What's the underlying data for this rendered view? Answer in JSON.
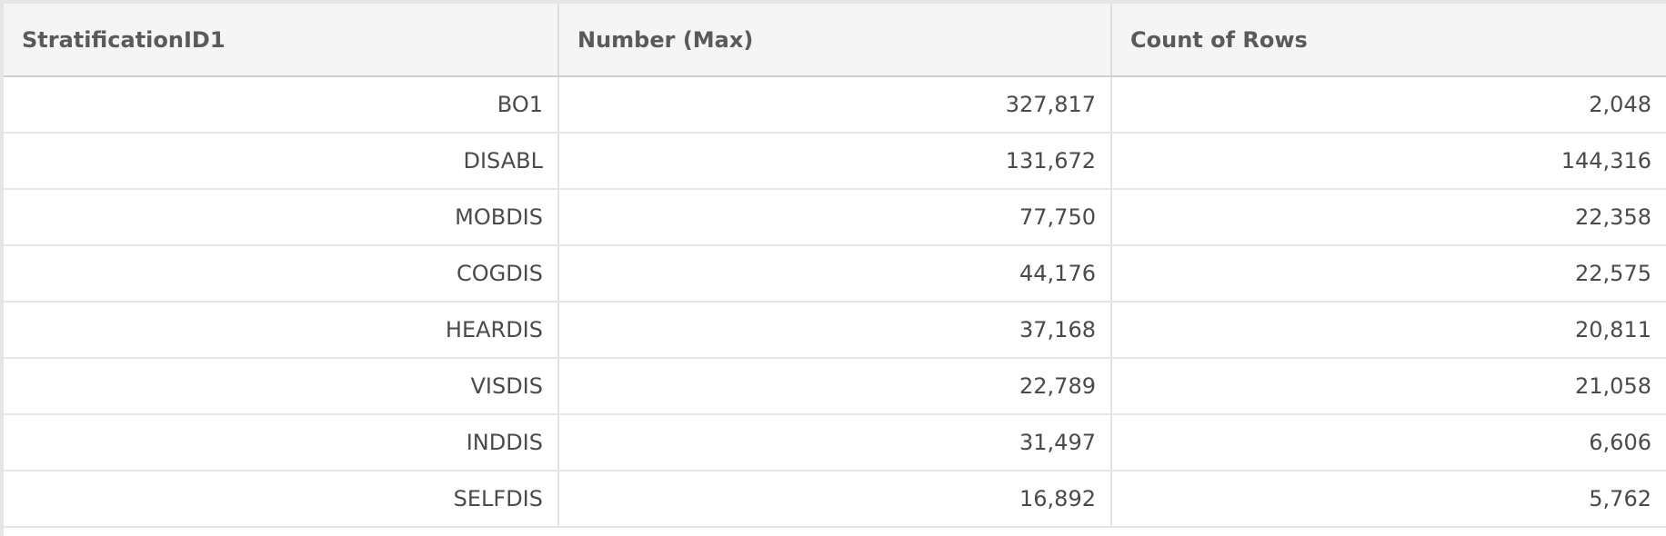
{
  "table": {
    "columns": [
      "StratificationID1",
      "Number (Max)",
      "Count of Rows"
    ],
    "rows": [
      [
        "BO1",
        "327,817",
        "2,048"
      ],
      [
        "DISABL",
        "131,672",
        "144,316"
      ],
      [
        "MOBDIS",
        "77,750",
        "22,358"
      ],
      [
        "COGDIS",
        "44,176",
        "22,575"
      ],
      [
        "HEARDIS",
        "37,168",
        "20,811"
      ],
      [
        "VISDIS",
        "22,789",
        "21,058"
      ],
      [
        "INDDIS",
        "31,497",
        "6,606"
      ],
      [
        "SELFDIS",
        "16,892",
        "5,762"
      ]
    ]
  }
}
